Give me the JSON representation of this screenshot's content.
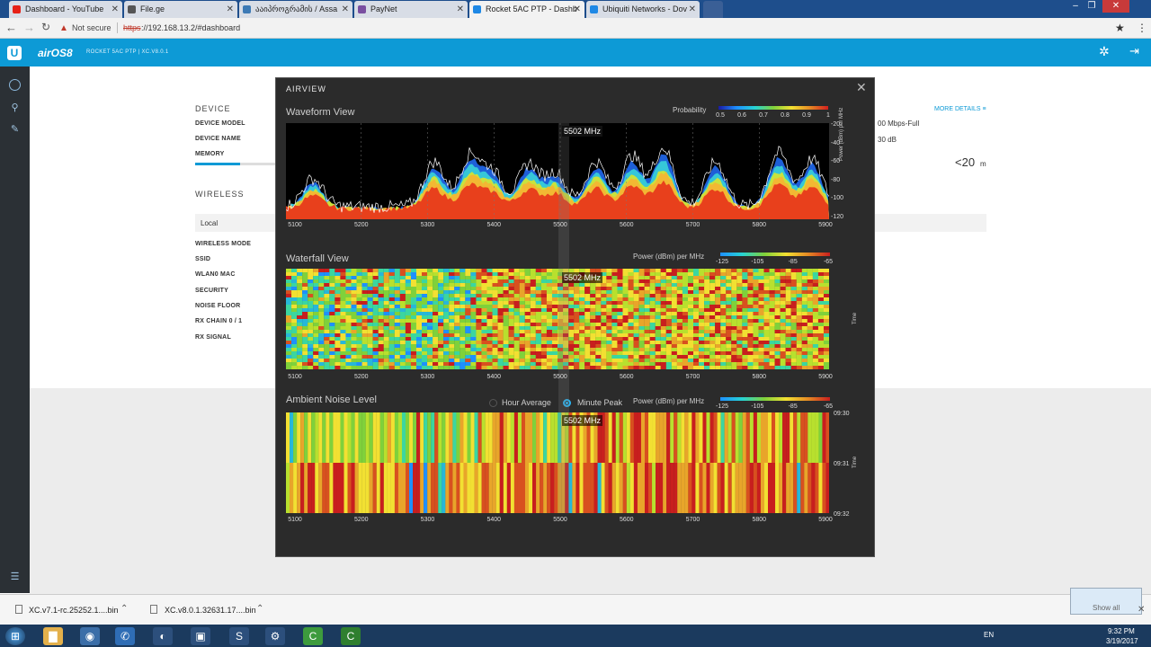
{
  "tabs": [
    {
      "label": "Dashboard - YouTube",
      "icon": "youtube-icon",
      "color": "#e62117"
    },
    {
      "label": "File.ge",
      "icon": "page-icon",
      "color": "#333333"
    },
    {
      "label": "ააიპროგრამის / Assa",
      "icon": "globe-icon",
      "color": "#3d7ab5"
    },
    {
      "label": "PayNet",
      "icon": "paynet-icon",
      "color": "#7a4fa0"
    },
    {
      "label": "Rocket 5AC PTP - Dashb",
      "icon": "wifi-icon",
      "color": "#1e88e5"
    },
    {
      "label": "Ubiquiti Networks - Dov",
      "icon": "ubiquiti-icon",
      "color": "#1e88e5"
    }
  ],
  "address": {
    "security": "Not secure",
    "scheme": "https",
    "url": "://192.168.13.2/#dashboard"
  },
  "header": {
    "brand": "airOS",
    "version_big": "8",
    "model": "ROCKET 5AC PTP | XC.V8.0.1"
  },
  "dashboard": {
    "device_heading": "DEVICE",
    "device_labels": [
      "DEVICE MODEL",
      "DEVICE NAME",
      "MEMORY"
    ],
    "wireless_heading": "WIRELESS",
    "local_label": "Local",
    "wireless_labels": [
      "WIRELESS MODE",
      "SSID",
      "WLAN0 MAC",
      "SECURITY",
      "NOISE FLOOR",
      "RX CHAIN 0 / 1",
      "RX SIGNAL"
    ],
    "more_details": "MORE DETAILS",
    "right_values": [
      "00 Mbps-Full",
      "30 dB"
    ],
    "distance": "<20",
    "distance_unit": "m"
  },
  "airview": {
    "title": "AIRVIEW",
    "marker_label": "5502 MHz",
    "x_ticks": [
      "5100",
      "5200",
      "5300",
      "5400",
      "5500",
      "5600",
      "5700",
      "5800",
      "5900"
    ],
    "waveform": {
      "title": "Waveform View",
      "prob_label": "Probability",
      "prob_ticks": [
        "0.5",
        "0.6",
        "0.7",
        "0.8",
        "0.9",
        "1"
      ],
      "y_ticks": [
        "-20",
        "-40",
        "-60",
        "-80",
        "-100",
        "-120"
      ],
      "y_label": "Power (dBm) per MHz"
    },
    "waterfall": {
      "title": "Waterfall View",
      "power_label": "Power (dBm) per MHz",
      "power_ticks": [
        "-125",
        "-105",
        "-85",
        "-65"
      ],
      "y_label": "Time"
    },
    "ambient": {
      "title": "Ambient Noise Level",
      "opt_hour": "Hour Average",
      "opt_minute": "Minute Peak",
      "power_label": "Power (dBm) per MHz",
      "power_ticks": [
        "-125",
        "-105",
        "-85",
        "-65"
      ],
      "time_ticks": [
        "09:30",
        "09:31",
        "09:32"
      ],
      "y_label": "Time"
    },
    "colors": {
      "low": "#1e90ff",
      "mid": "#7fd13b",
      "high": "#f2e032",
      "peak": "#c81e1e"
    }
  },
  "downloads": [
    {
      "name": "XC.v7.1-rc.25252.1....bin"
    },
    {
      "name": "XC.v8.0.1.32631.17....bin"
    }
  ],
  "show_all": "Show all",
  "taskbar": {
    "lang": "EN",
    "time": "9:32 PM",
    "date": "3/19/2017"
  }
}
